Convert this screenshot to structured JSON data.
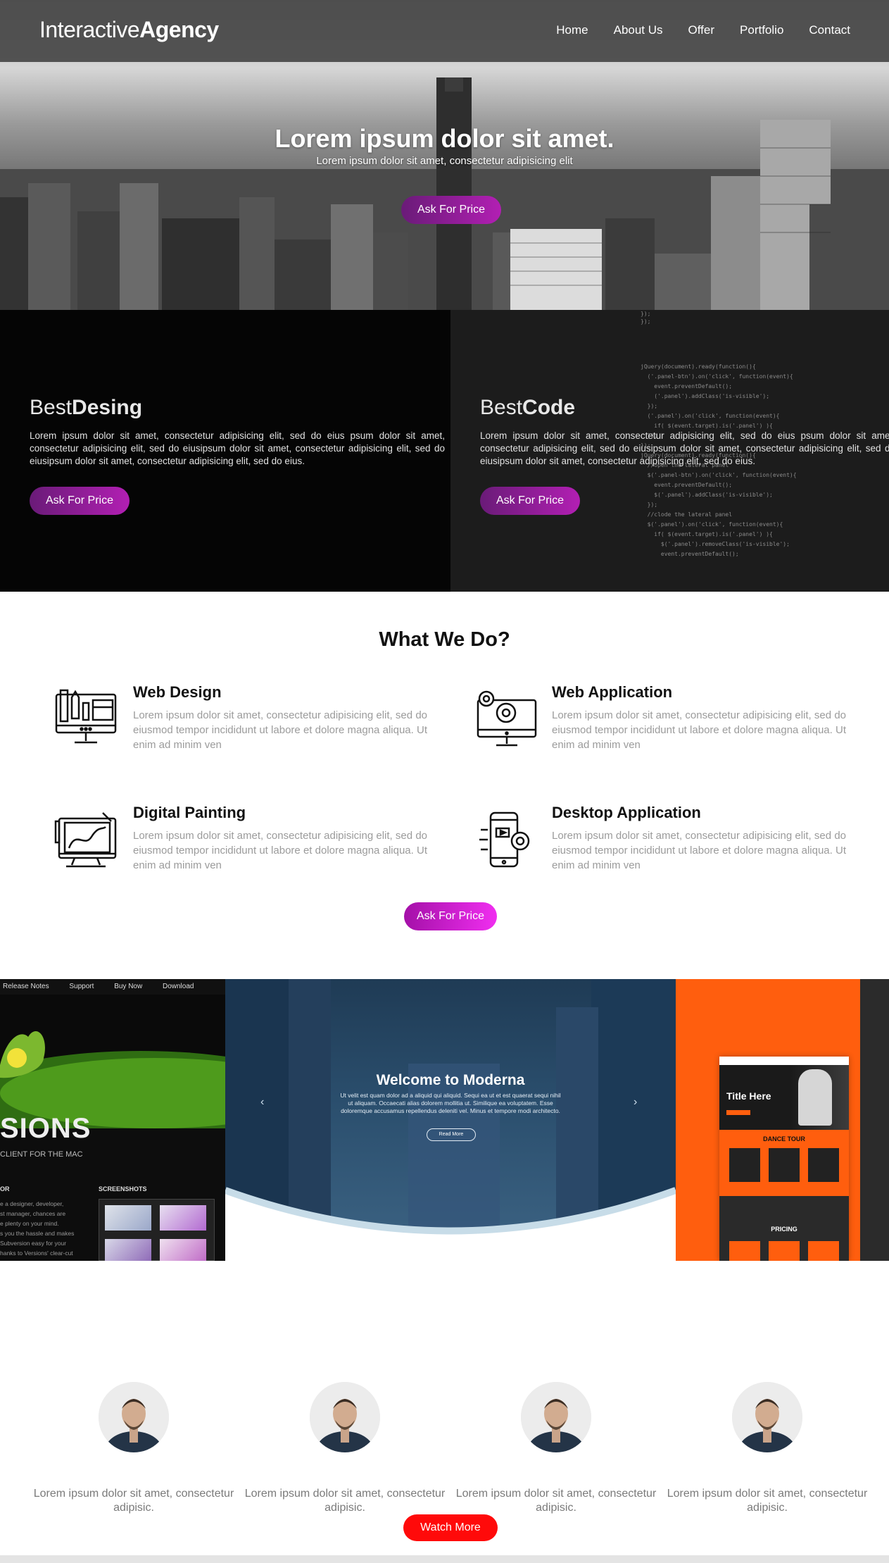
{
  "nav": {
    "logo_light": "Interactive",
    "logo_bold": "Agency",
    "items": [
      "Home",
      "About Us",
      "Offer",
      "Portfolio",
      "Contact"
    ]
  },
  "hero": {
    "title": "Lorem ipsum dolor sit amet.",
    "subtitle": "Lorem ipsum dolor sit amet, consectetur adipisicing elit",
    "button": "Ask For Price"
  },
  "features": [
    {
      "title_light": "Best",
      "title_bold": "Desing",
      "text": "Lorem ipsum dolor sit amet, consectetur adipisicing elit, sed do eius psum dolor sit amet, consectetur adipisicing elit, sed do eiusipsum dolor sit amet, consectetur adipisicing elit, sed do eiusipsum dolor sit amet, consectetur adipisicing elit, sed do eius.",
      "button": "Ask For Price"
    },
    {
      "title_light": "Best",
      "title_bold": "Code",
      "text": "Lorem ipsum dolor sit amet, consectetur adipisicing elit, sed do eius psum dolor sit amet, consectetur adipisicing elit, sed do eiusipsum dolor sit amet, consectetur adipisicing elit, sed do eiusipsum dolor sit amet, consectetur adipisicing elit, sed do eius.",
      "button": "Ask For Price",
      "code_lines": [
        "});",
        "});",
        "jQuery(document).ready(function(){",
        "  ('.panel-btn').on('click', function(event){",
        "    event.preventDefault();",
        "    ('.panel').addClass('is-visible');",
        "  });",
        "  ('.panel').on('click', function(event){",
        "    if( $(event.target).is('.panel') ){",
        "  });",
        "});",
        "jQuery(document).ready(function(){",
        "  //open the lateral panel",
        "  $('.panel-btn').on('click', function(event){",
        "    event.preventDefault();",
        "    $('.panel').addClass('is-visible');",
        "  });",
        "  //clode the lateral panel",
        "  $('.panel').on('click', function(event){",
        "    if( $(event.target).is('.panel') ){",
        "      $('.panel').removeClass('is-visible');",
        "      event.preventDefault();"
      ]
    }
  ],
  "services": {
    "title": "What We Do?",
    "items": [
      {
        "icon": "monitor-design-icon",
        "title": "Web Design",
        "text": "Lorem ipsum dolor sit amet, consectetur adipisicing elit, sed do eiusmod tempor incididunt ut labore et dolore magna aliqua. Ut enim ad minim ven"
      },
      {
        "icon": "monitor-gears-icon",
        "title": "Web Application",
        "text": "Lorem ipsum dolor sit amet, consectetur adipisicing elit, sed do eiusmod tempor incididunt ut labore et dolore magna aliqua. Ut enim ad minim ven"
      },
      {
        "icon": "drawing-tablet-icon",
        "title": "Digital Painting",
        "text": "Lorem ipsum dolor sit amet, consectetur adipisicing elit, sed do eiusmod tempor incididunt ut labore et dolore magna aliqua. Ut enim ad minim ven"
      },
      {
        "icon": "phone-gear-icon",
        "title": "Desktop Application",
        "text": "Lorem ipsum dolor sit amet, consectetur adipisicing elit, sed do eiusmod tempor incididunt ut labore et dolore magna aliqua. Ut enim ad minim ven"
      }
    ],
    "button": "Ask For Price"
  },
  "gallery": {
    "left": {
      "topbar": [
        "Release Notes",
        "Support",
        "Buy Now",
        "Download"
      ],
      "headline": "SIONS",
      "tagline": "CLIENT FOR THE MAC",
      "col_left_title": "OR",
      "col_right_title": "SCREENSHOTS",
      "body_lines": [
        "e a designer, developer,",
        "st manager, chances are",
        "e plenty on your mind.",
        "s you the hassle and makes",
        "Subversion easy for your",
        "hanks to Versions' clear-cut"
      ]
    },
    "middle": {
      "title": "Welcome to Moderna",
      "text": "Ut velit est quam dolor ad a aliquid qui aliquid. Sequi ea ut et est quaerat sequi nihil ut aliquam. Occaecati alias dolorem mollitia ut. Similique ea voluptatem. Esse doloremque accusamus repellendus deleniti vel. Minus et tempore modi architecto.",
      "button": "Read More"
    },
    "right": {
      "title": "Title Here",
      "section1": "DANCE TOUR",
      "section2": "PRICING"
    }
  },
  "team": {
    "members": [
      {
        "text": "Lorem ipsum dolor sit amet, consectetur adipisic."
      },
      {
        "text": "Lorem ipsum dolor sit amet, consectetur adipisic."
      },
      {
        "text": "Lorem ipsum dolor sit amet, consectetur adipisic."
      },
      {
        "text": "Lorem ipsum dolor sit amet, consectetur adipisic."
      }
    ],
    "button": "Watch More"
  },
  "colors": {
    "accent_purple": "#8e1e9a",
    "accent_magenta": "#d61fd6",
    "accent_red": "#ff0a0a",
    "orange": "#ff5e0e"
  }
}
